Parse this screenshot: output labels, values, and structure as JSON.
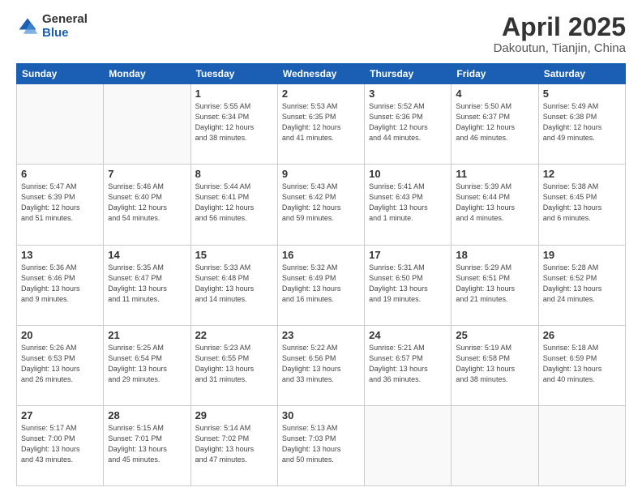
{
  "header": {
    "logo_general": "General",
    "logo_blue": "Blue",
    "title": "April 2025",
    "subtitle": "Dakoutun, Tianjin, China"
  },
  "weekdays": [
    "Sunday",
    "Monday",
    "Tuesday",
    "Wednesday",
    "Thursday",
    "Friday",
    "Saturday"
  ],
  "weeks": [
    [
      {
        "day": "",
        "info": ""
      },
      {
        "day": "",
        "info": ""
      },
      {
        "day": "1",
        "info": "Sunrise: 5:55 AM\nSunset: 6:34 PM\nDaylight: 12 hours\nand 38 minutes."
      },
      {
        "day": "2",
        "info": "Sunrise: 5:53 AM\nSunset: 6:35 PM\nDaylight: 12 hours\nand 41 minutes."
      },
      {
        "day": "3",
        "info": "Sunrise: 5:52 AM\nSunset: 6:36 PM\nDaylight: 12 hours\nand 44 minutes."
      },
      {
        "day": "4",
        "info": "Sunrise: 5:50 AM\nSunset: 6:37 PM\nDaylight: 12 hours\nand 46 minutes."
      },
      {
        "day": "5",
        "info": "Sunrise: 5:49 AM\nSunset: 6:38 PM\nDaylight: 12 hours\nand 49 minutes."
      }
    ],
    [
      {
        "day": "6",
        "info": "Sunrise: 5:47 AM\nSunset: 6:39 PM\nDaylight: 12 hours\nand 51 minutes."
      },
      {
        "day": "7",
        "info": "Sunrise: 5:46 AM\nSunset: 6:40 PM\nDaylight: 12 hours\nand 54 minutes."
      },
      {
        "day": "8",
        "info": "Sunrise: 5:44 AM\nSunset: 6:41 PM\nDaylight: 12 hours\nand 56 minutes."
      },
      {
        "day": "9",
        "info": "Sunrise: 5:43 AM\nSunset: 6:42 PM\nDaylight: 12 hours\nand 59 minutes."
      },
      {
        "day": "10",
        "info": "Sunrise: 5:41 AM\nSunset: 6:43 PM\nDaylight: 13 hours\nand 1 minute."
      },
      {
        "day": "11",
        "info": "Sunrise: 5:39 AM\nSunset: 6:44 PM\nDaylight: 13 hours\nand 4 minutes."
      },
      {
        "day": "12",
        "info": "Sunrise: 5:38 AM\nSunset: 6:45 PM\nDaylight: 13 hours\nand 6 minutes."
      }
    ],
    [
      {
        "day": "13",
        "info": "Sunrise: 5:36 AM\nSunset: 6:46 PM\nDaylight: 13 hours\nand 9 minutes."
      },
      {
        "day": "14",
        "info": "Sunrise: 5:35 AM\nSunset: 6:47 PM\nDaylight: 13 hours\nand 11 minutes."
      },
      {
        "day": "15",
        "info": "Sunrise: 5:33 AM\nSunset: 6:48 PM\nDaylight: 13 hours\nand 14 minutes."
      },
      {
        "day": "16",
        "info": "Sunrise: 5:32 AM\nSunset: 6:49 PM\nDaylight: 13 hours\nand 16 minutes."
      },
      {
        "day": "17",
        "info": "Sunrise: 5:31 AM\nSunset: 6:50 PM\nDaylight: 13 hours\nand 19 minutes."
      },
      {
        "day": "18",
        "info": "Sunrise: 5:29 AM\nSunset: 6:51 PM\nDaylight: 13 hours\nand 21 minutes."
      },
      {
        "day": "19",
        "info": "Sunrise: 5:28 AM\nSunset: 6:52 PM\nDaylight: 13 hours\nand 24 minutes."
      }
    ],
    [
      {
        "day": "20",
        "info": "Sunrise: 5:26 AM\nSunset: 6:53 PM\nDaylight: 13 hours\nand 26 minutes."
      },
      {
        "day": "21",
        "info": "Sunrise: 5:25 AM\nSunset: 6:54 PM\nDaylight: 13 hours\nand 29 minutes."
      },
      {
        "day": "22",
        "info": "Sunrise: 5:23 AM\nSunset: 6:55 PM\nDaylight: 13 hours\nand 31 minutes."
      },
      {
        "day": "23",
        "info": "Sunrise: 5:22 AM\nSunset: 6:56 PM\nDaylight: 13 hours\nand 33 minutes."
      },
      {
        "day": "24",
        "info": "Sunrise: 5:21 AM\nSunset: 6:57 PM\nDaylight: 13 hours\nand 36 minutes."
      },
      {
        "day": "25",
        "info": "Sunrise: 5:19 AM\nSunset: 6:58 PM\nDaylight: 13 hours\nand 38 minutes."
      },
      {
        "day": "26",
        "info": "Sunrise: 5:18 AM\nSunset: 6:59 PM\nDaylight: 13 hours\nand 40 minutes."
      }
    ],
    [
      {
        "day": "27",
        "info": "Sunrise: 5:17 AM\nSunset: 7:00 PM\nDaylight: 13 hours\nand 43 minutes."
      },
      {
        "day": "28",
        "info": "Sunrise: 5:15 AM\nSunset: 7:01 PM\nDaylight: 13 hours\nand 45 minutes."
      },
      {
        "day": "29",
        "info": "Sunrise: 5:14 AM\nSunset: 7:02 PM\nDaylight: 13 hours\nand 47 minutes."
      },
      {
        "day": "30",
        "info": "Sunrise: 5:13 AM\nSunset: 7:03 PM\nDaylight: 13 hours\nand 50 minutes."
      },
      {
        "day": "",
        "info": ""
      },
      {
        "day": "",
        "info": ""
      },
      {
        "day": "",
        "info": ""
      }
    ]
  ]
}
